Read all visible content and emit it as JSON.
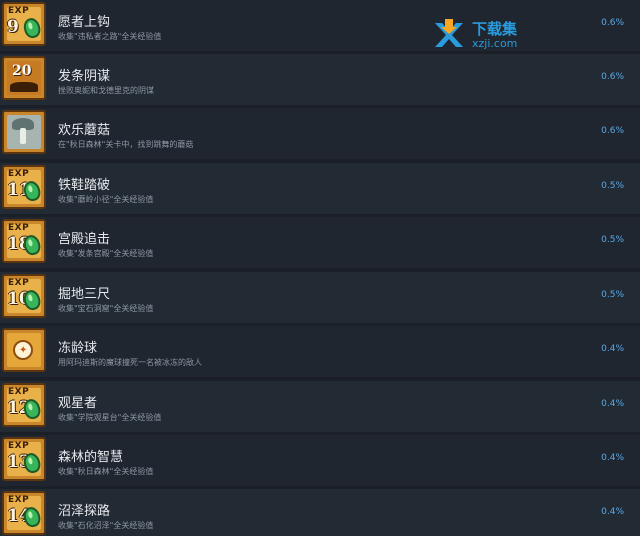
{
  "achievements": [
    {
      "icon": "exp",
      "exp_label": "EXP",
      "exp_num": "9",
      "title": "愿者上钩",
      "desc": "收集\"违私者之路\"全关经验值",
      "percent": "0.6%"
    },
    {
      "icon": "twenty",
      "exp_num": "20",
      "title": "发条阴谋",
      "desc": "挫败奥妮和戈德里克的阴谋",
      "percent": "0.6%"
    },
    {
      "icon": "mushroom",
      "title": "欢乐蘑菇",
      "desc": "在\"秋日森林\"关卡中，找到跳舞的蘑菇",
      "percent": "0.6%"
    },
    {
      "icon": "exp",
      "exp_label": "EXP",
      "exp_num": "11",
      "title": "铁鞋踏破",
      "desc": "收集\"蘑岭小径\"全关经验值",
      "percent": "0.5%"
    },
    {
      "icon": "exp",
      "exp_label": "EXP",
      "exp_num": "18",
      "title": "宫殿追击",
      "desc": "收集\"发条宫殿\"全关经验值",
      "percent": "0.5%"
    },
    {
      "icon": "exp",
      "exp_label": "EXP",
      "exp_num": "10",
      "title": "掘地三尺",
      "desc": "收集\"宝石洞窟\"全关经验值",
      "percent": "0.5%"
    },
    {
      "icon": "ball",
      "title": "冻龄球",
      "desc": "用阿玛迪斯的魔球撞死一名被冰冻的敌人",
      "percent": "0.4%"
    },
    {
      "icon": "exp",
      "exp_label": "EXP",
      "exp_num": "12",
      "title": "观星者",
      "desc": "收集\"学院观星台\"全关经验值",
      "percent": "0.4%"
    },
    {
      "icon": "exp",
      "exp_label": "EXP",
      "exp_num": "13",
      "title": "森林的智慧",
      "desc": "收集\"秋日森林\"全关经验值",
      "percent": "0.4%"
    },
    {
      "icon": "exp",
      "exp_label": "EXP",
      "exp_num": "14",
      "title": "沼泽探路",
      "desc": "收集\"石化沼泽\"全关经验值",
      "percent": "0.4%"
    }
  ],
  "watermark": {
    "line1": "下载集",
    "line2": "xzji.com"
  },
  "colors": {
    "percent": "#5aa9e6",
    "row": "#222a34",
    "accent_gold": "#c9862a",
    "gem": "#38b55a"
  }
}
